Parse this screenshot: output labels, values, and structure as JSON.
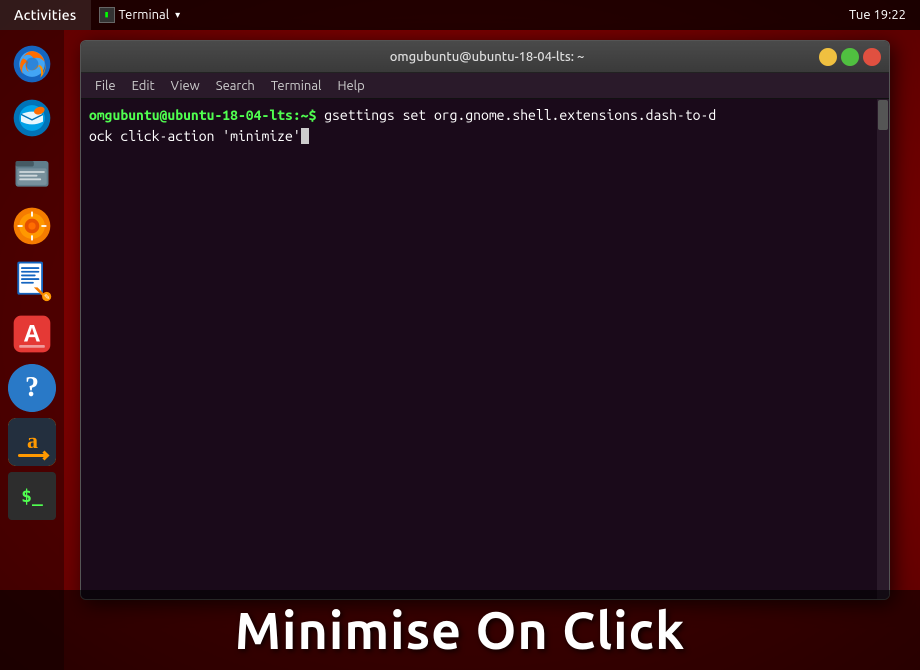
{
  "topbar": {
    "activities_label": "Activities",
    "terminal_label": "Terminal",
    "terminal_arrow": "▾",
    "clock": "Tue 19:22"
  },
  "dock": {
    "icons": [
      {
        "id": "firefox",
        "name": "Firefox web browser",
        "label": "Firefox"
      },
      {
        "id": "thunderbird",
        "name": "Thunderbird mail",
        "label": "Thunderbird"
      },
      {
        "id": "files",
        "name": "Files file manager",
        "label": "Files"
      },
      {
        "id": "rhythmbox",
        "name": "Rhythmbox music player",
        "label": "Rhythmbox"
      },
      {
        "id": "writer",
        "name": "LibreOffice Writer",
        "label": "Writer"
      },
      {
        "id": "appstore",
        "name": "Ubuntu Software Center",
        "label": "Software"
      },
      {
        "id": "help",
        "name": "Help and support",
        "label": "?"
      },
      {
        "id": "amazon",
        "name": "Amazon",
        "label": "a"
      },
      {
        "id": "terminal",
        "name": "Terminal",
        "label": ">_"
      }
    ]
  },
  "terminal_window": {
    "title": "omgubuntu@ubuntu-18-04-lts: ~",
    "menu_items": [
      "File",
      "Edit",
      "View",
      "Search",
      "Terminal",
      "Help"
    ],
    "btn_minimize": "–",
    "btn_maximize": "□",
    "btn_close": "✕",
    "prompt_user": "omgubuntu@ubuntu-18-04-lts:~$",
    "command": " gsettings set org.gnome.shell.extensions.dash-to-dock click-action 'minimize'"
  },
  "overlay": {
    "title": "Minimise On Click"
  },
  "colors": {
    "prompt_green": "#50ff50",
    "terminal_bg": "#1a0a1a",
    "topbar_bg": "rgba(0,0,0,0.7)",
    "ubuntu_red": "#c0392b"
  }
}
